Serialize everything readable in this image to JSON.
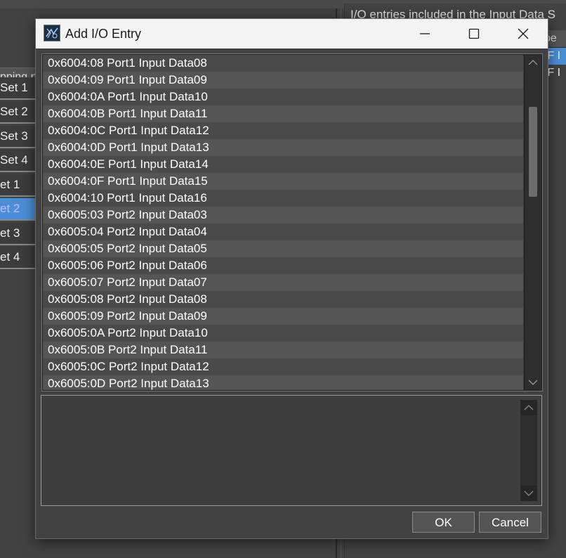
{
  "background": {
    "left_panel": {
      "header": "pping n",
      "rows": [
        {
          "label": "Set 1",
          "selected": false
        },
        {
          "label": "Set 2",
          "selected": false
        },
        {
          "label": "Set 3",
          "selected": false
        },
        {
          "label": "Set 4",
          "selected": false
        },
        {
          "label": "et 1",
          "selected": false
        },
        {
          "label": "et 2",
          "selected": true
        },
        {
          "label": "et 3",
          "selected": false
        },
        {
          "label": "et 4",
          "selected": false
        }
      ]
    },
    "right_panel": {
      "title": "I/O entries included in the Input Data S",
      "column_header": "ype",
      "cells": [
        "OF I",
        "OF I"
      ]
    }
  },
  "dialog": {
    "title": "Add I/O Entry",
    "icons": {
      "app": "app-icon",
      "minimize": "minimize-icon",
      "maximize": "maximize-icon",
      "close": "close-icon"
    },
    "entries": [
      "0x6004:08 Port1 Input Data08",
      "0x6004:09 Port1 Input Data09",
      "0x6004:0A Port1 Input Data10",
      "0x6004:0B Port1 Input Data11",
      "0x6004:0C Port1 Input Data12",
      "0x6004:0D Port1 Input Data13",
      "0x6004:0E Port1 Input Data14",
      "0x6004:0F Port1 Input Data15",
      "0x6004:10 Port1 Input Data16",
      "0x6005:03 Port2 Input Data03",
      "0x6005:04 Port2 Input Data04",
      "0x6005:05 Port2 Input Data05",
      "0x6005:06 Port2 Input Data06",
      "0x6005:07 Port2 Input Data07",
      "0x6005:08 Port2 Input Data08",
      "0x6005:09 Port2 Input Data09",
      "0x6005:0A Port2 Input Data10",
      "0x6005:0B Port2 Input Data11",
      "0x6005:0C Port2 Input Data12",
      "0x6005:0D Port2 Input Data13"
    ],
    "description": "",
    "ok_label": "OK",
    "cancel_label": "Cancel"
  },
  "colors": {
    "background": "#424242",
    "titlebar": "#f3f3f3",
    "row_odd": "#4a4a4a",
    "row_even": "#555555",
    "selection": "#4a8fd6"
  }
}
